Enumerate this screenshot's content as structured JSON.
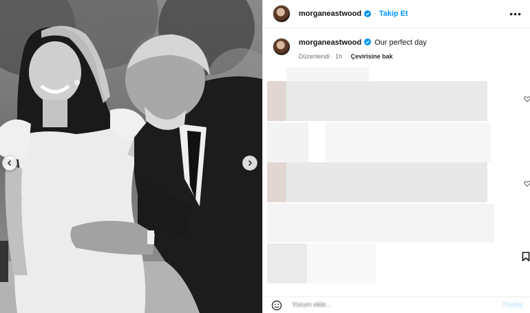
{
  "post": {
    "username": "morganeastwood",
    "follow_label": "Takip Et",
    "more_label": "•••",
    "caption": "Our perfect day",
    "edited_label": "Düzenlendi",
    "time_ago": "1h",
    "translate_label": "Çevirisine bak",
    "meta_separator": "·"
  },
  "comment_box": {
    "placeholder": "Yorum ekle...",
    "post_label": "Paylaş"
  },
  "icons": {
    "verified": "verified-badge-icon",
    "prev": "chevron-left-icon",
    "next": "chevron-right-icon",
    "like": "heart-icon",
    "save": "bookmark-icon",
    "emoji": "smiley-icon"
  },
  "colors": {
    "accent": "#0095f6",
    "verified": "#0095f6",
    "border": "#dbdbdb"
  }
}
